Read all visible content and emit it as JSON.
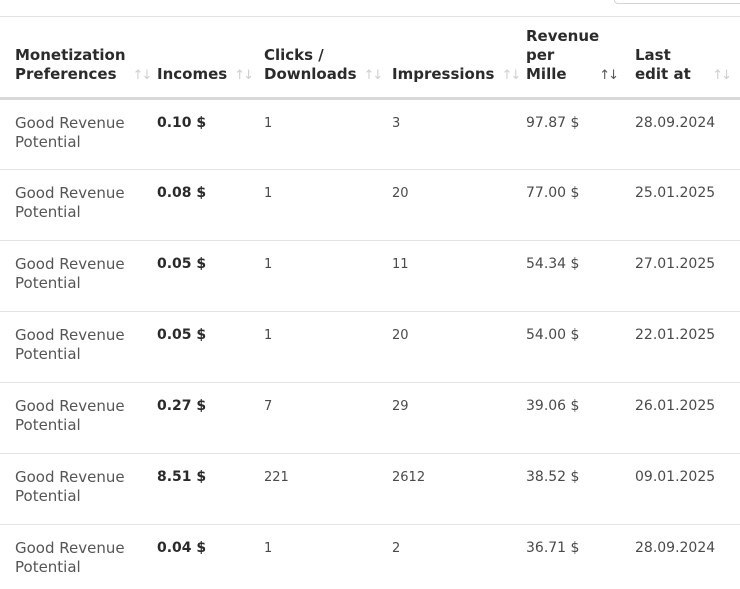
{
  "table": {
    "headers": [
      {
        "label": "Monetization\nPreferences"
      },
      {
        "label": "Incomes"
      },
      {
        "label": "Clicks /\nDownloads"
      },
      {
        "label": "Impressions"
      },
      {
        "label": "Revenue\nper\nMille"
      },
      {
        "label": "Last\nedit at"
      }
    ],
    "sort_icon_glyph": "↑↓",
    "rows": [
      {
        "preference": "Good Revenue Potential",
        "income": "0.10 $",
        "clicks": "1",
        "impressions": "3",
        "rpm": "97.87 $",
        "last_edit": "28.09.2024"
      },
      {
        "preference": "Good Revenue Potential",
        "income": "0.08 $",
        "clicks": "1",
        "impressions": "20",
        "rpm": "77.00 $",
        "last_edit": "25.01.2025"
      },
      {
        "preference": "Good Revenue Potential",
        "income": "0.05 $",
        "clicks": "1",
        "impressions": "11",
        "rpm": "54.34 $",
        "last_edit": "27.01.2025"
      },
      {
        "preference": "Good Revenue Potential",
        "income": "0.05 $",
        "clicks": "1",
        "impressions": "20",
        "rpm": "54.00 $",
        "last_edit": "22.01.2025"
      },
      {
        "preference": "Good Revenue Potential",
        "income": "0.27 $",
        "clicks": "7",
        "impressions": "29",
        "rpm": "39.06 $",
        "last_edit": "26.01.2025"
      },
      {
        "preference": "Good Revenue Potential",
        "income": "8.51 $",
        "clicks": "221",
        "impressions": "2612",
        "rpm": "38.52 $",
        "last_edit": "09.01.2025"
      },
      {
        "preference": "Good Revenue Potential",
        "income": "0.04 $",
        "clicks": "1",
        "impressions": "2",
        "rpm": "36.71 $",
        "last_edit": "28.09.2024"
      }
    ]
  }
}
